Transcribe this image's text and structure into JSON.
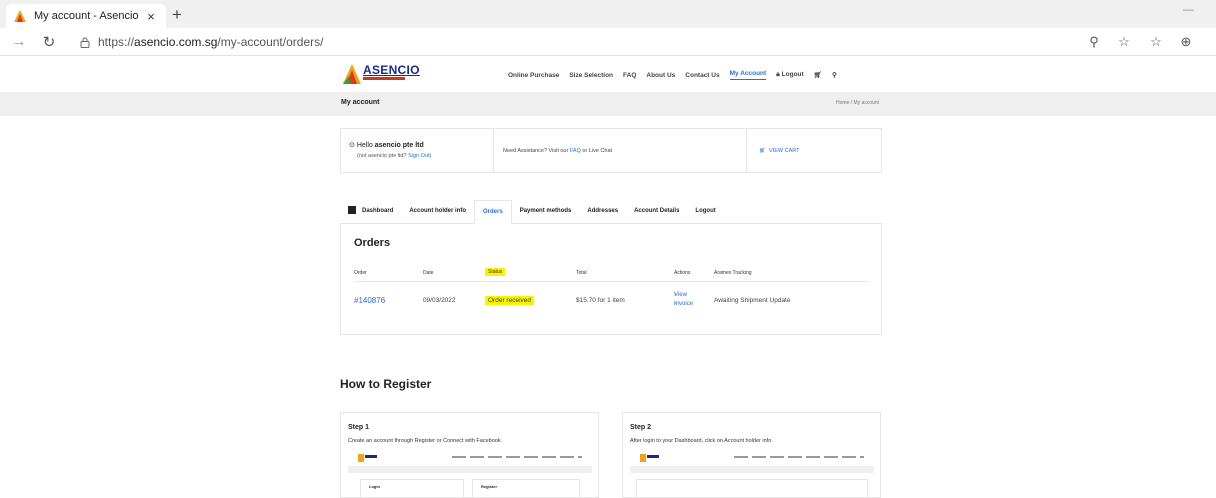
{
  "browser": {
    "tab_title": "My account - Asencio",
    "url_prefix": "https://",
    "url_host": "asencio.com.sg",
    "url_path": "/my-account/orders/"
  },
  "site": {
    "logo_text": "ASENCIO",
    "nav": [
      "Online Purchase",
      "Size Selection",
      "FAQ",
      "About Us",
      "Contact Us",
      "My Account",
      "Logout"
    ],
    "active_nav": "My Account",
    "page_title": "My account",
    "breadcrumb": "Home / My account"
  },
  "info": {
    "hello_prefix": "Hello ",
    "user": "asencio pte ltd",
    "not_prefix": "(not asencio pte ltd? ",
    "sign_out": "Sign Out",
    "not_suffix": ")",
    "assist_prefix": "Need Assistance? Visit our ",
    "faq": "FAQ",
    "assist_suffix": " or Live Chat",
    "view_cart": "VIEW CART"
  },
  "account_tabs": [
    "Dashboard",
    "Account holder info",
    "Orders",
    "Payment methods",
    "Addresses",
    "Account Details",
    "Logout"
  ],
  "orders": {
    "heading": "Orders",
    "columns": [
      "Order",
      "Date",
      "Status",
      "Total",
      "Actions",
      "Aramex Tracking"
    ],
    "rows": [
      {
        "order": "#140876",
        "date": "09/03/2022",
        "status": "Order received",
        "total": "$15.70 for 1 item",
        "action_view": "View",
        "action_invoice": "Invoice",
        "tracking": "Awaiting Shipment Update"
      }
    ]
  },
  "register": {
    "heading": "How to Register",
    "steps": [
      {
        "title": "Step 1",
        "desc": "Create an account through Register or Connect with Facebook.",
        "box1": "Login",
        "box2": "Register"
      },
      {
        "title": "Step 2",
        "desc": "After login to your Dashboard, click on Account holder info."
      }
    ]
  },
  "colors": {
    "accent": "#2b6fd6",
    "highlight": "#f6f400",
    "brand_navy": "#1a2a8a"
  }
}
